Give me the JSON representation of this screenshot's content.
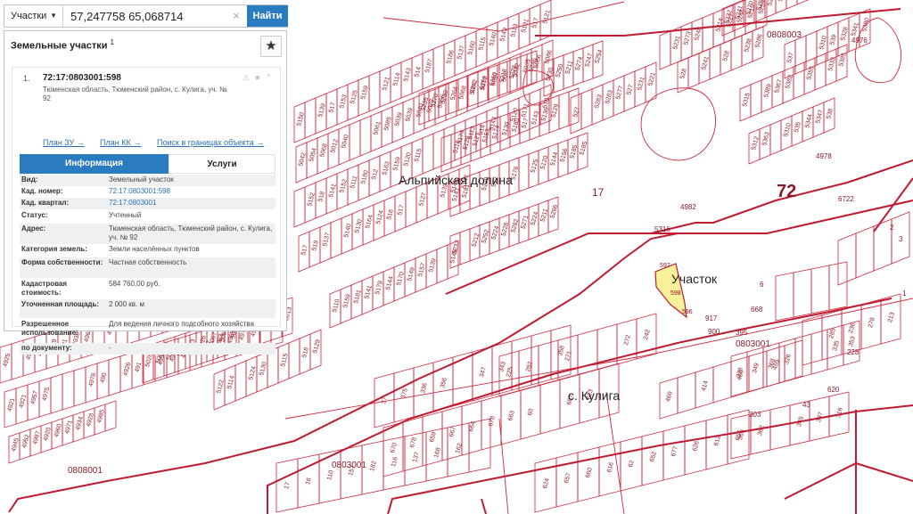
{
  "search": {
    "type_label": "Участки",
    "query": "57,247758 65,068714",
    "clear_icon": "×",
    "go_label": "Найти"
  },
  "panel": {
    "title": "Земельные участки",
    "title_sup": "1",
    "favorite_icon": "★",
    "item": {
      "index": "1.",
      "cad_number": "72:17:0803001:598",
      "address": "Тюменская область, Тюменский район, с. Кулига, уч. № 92",
      "status_icons": "⚠ ★ ⌃",
      "links": {
        "plan_zu": "План ЗУ →",
        "plan_kk": "План КК →",
        "search_bounds": "Поиск в границах объекта →"
      },
      "tabs": {
        "info": "Информация",
        "services": "Услуги"
      },
      "fields": [
        {
          "key": "Вид:",
          "value": "Земельный участок",
          "link": false
        },
        {
          "key": "Кад. номер:",
          "value": "72:17:0803001:598",
          "link": true
        },
        {
          "key": "Кад. квартал:",
          "value": "72:17:0803001",
          "link": true
        },
        {
          "key": "Статус:",
          "value": "Учтенный",
          "link": false
        },
        {
          "key": "Адрес:",
          "value": "Тюменская область, Тюменский район, с. Кулига, уч. № 92",
          "link": false
        },
        {
          "key": "Категория земель:",
          "value": "Земли населённых пунктов",
          "link": false
        },
        {
          "key": "Форма собственности:",
          "value": "Частная собственность",
          "link": false
        },
        {
          "key": "Кадастровая стоимость:",
          "value": "584 760,00 руб.",
          "link": false
        },
        {
          "key": "Уточненная площадь:",
          "value": "2 000 кв. м",
          "link": false
        },
        {
          "key": "Разрешенное использование:",
          "value": "Для ведения личного подсобного хозяйства",
          "link": false
        },
        {
          "key": "по документу:",
          "value": "-",
          "link": false
        }
      ]
    }
  },
  "map": {
    "colors": {
      "line": "#d0283c",
      "boundary": "#c01a30",
      "selected_fill": "#f7f29a",
      "text": "#8a1a2a"
    },
    "labels": {
      "alpine": "Альпийская долина",
      "selected": "Участок",
      "village": "с. Кулига",
      "region": "72",
      "alpine_num": "17",
      "q_0808003": "0808003",
      "q_0803001a": "0803001",
      "q_0803001b": "0803001",
      "q_0808001": "0808001",
      "p_4976": "4976",
      "p_4978": "4978",
      "p_6722": "6722",
      "p_4982": "4982",
      "p_5316": "5316",
      "p_917": "917",
      "p_900": "900",
      "p_395": "395",
      "p_43": "43",
      "p_303": "303",
      "p_620": "620",
      "p_228": "228",
      "p_3": "3",
      "p_2": "2",
      "p_1": "1",
      "p_6": "6",
      "p_668": "668"
    }
  }
}
